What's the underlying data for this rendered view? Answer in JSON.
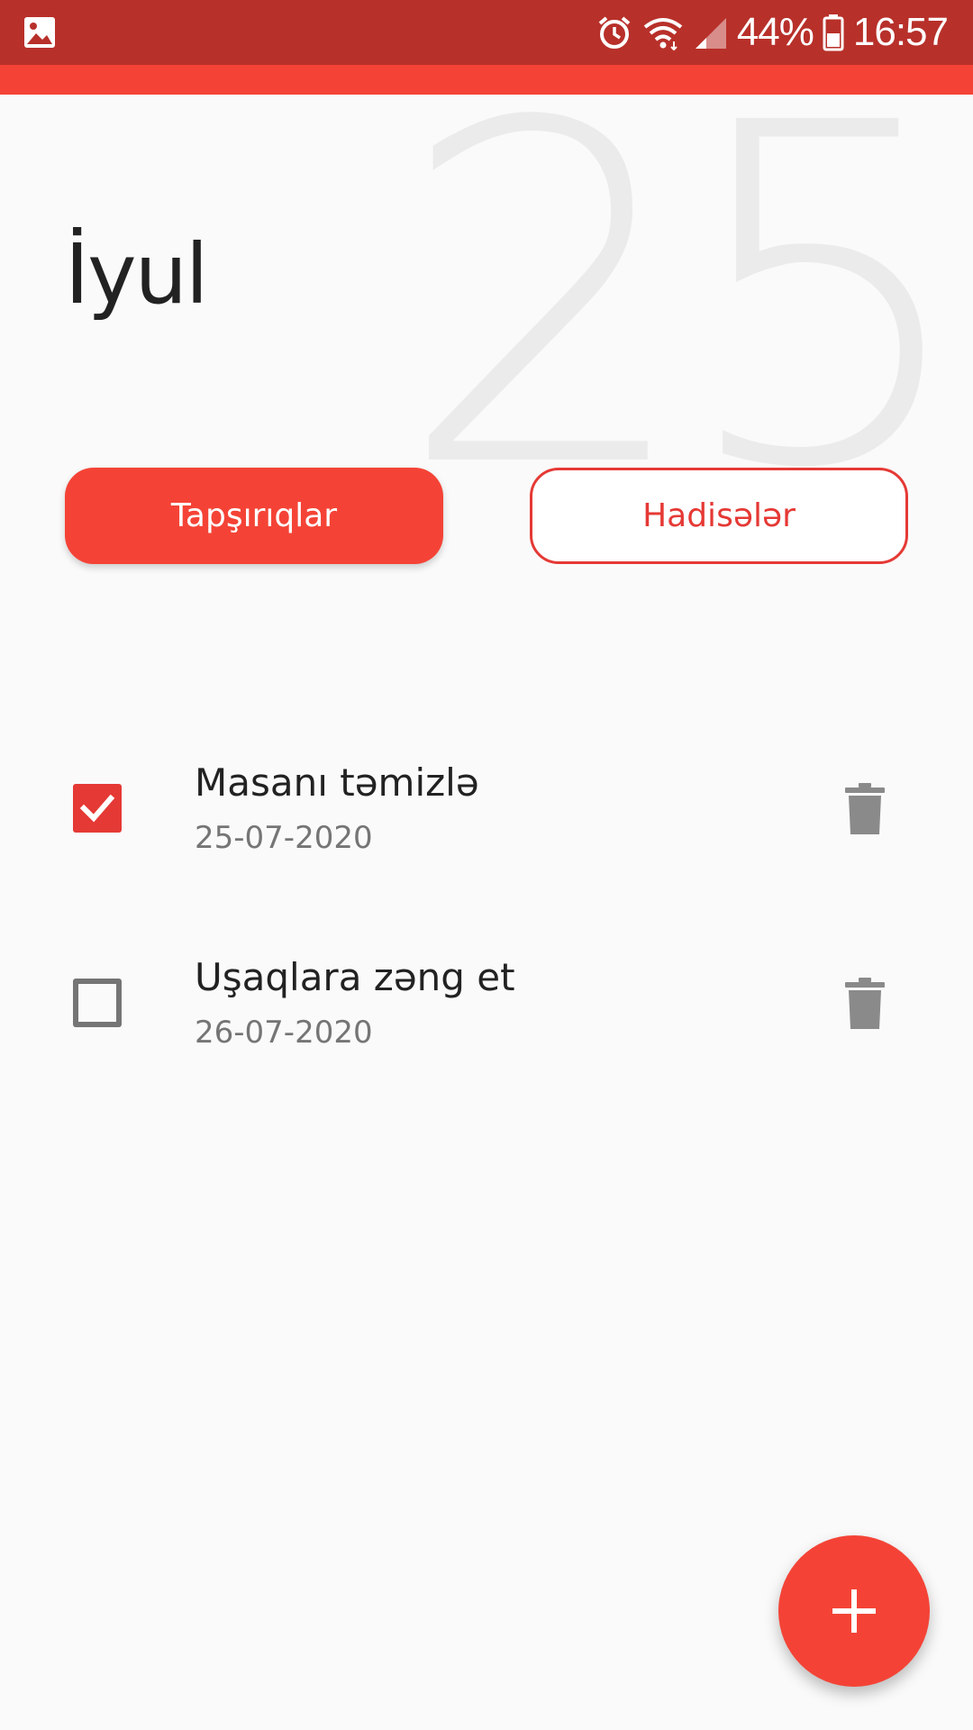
{
  "status_bar": {
    "battery": "44%",
    "time": "16:57",
    "icons": [
      "gallery-icon",
      "alarm-icon",
      "wifi-icon",
      "signal-icon",
      "battery-icon"
    ]
  },
  "header": {
    "day_number": "25",
    "month": "İyul"
  },
  "tabs": [
    {
      "label": "Tapşırıqlar",
      "active": true
    },
    {
      "label": "Hadisələr",
      "active": false
    }
  ],
  "tasks": [
    {
      "title": "Masanı təmizlə",
      "date": "25-07-2020",
      "done": true
    },
    {
      "title": "Uşaqlara zəng et",
      "date": "26-07-2020",
      "done": false
    }
  ],
  "fab": {
    "icon": "plus-icon"
  },
  "colors": {
    "accent": "#f44336",
    "status_bar": "#b8302a",
    "checkbox_checked": "#e53935",
    "muted": "#757575",
    "big_number": "#ebebeb"
  }
}
